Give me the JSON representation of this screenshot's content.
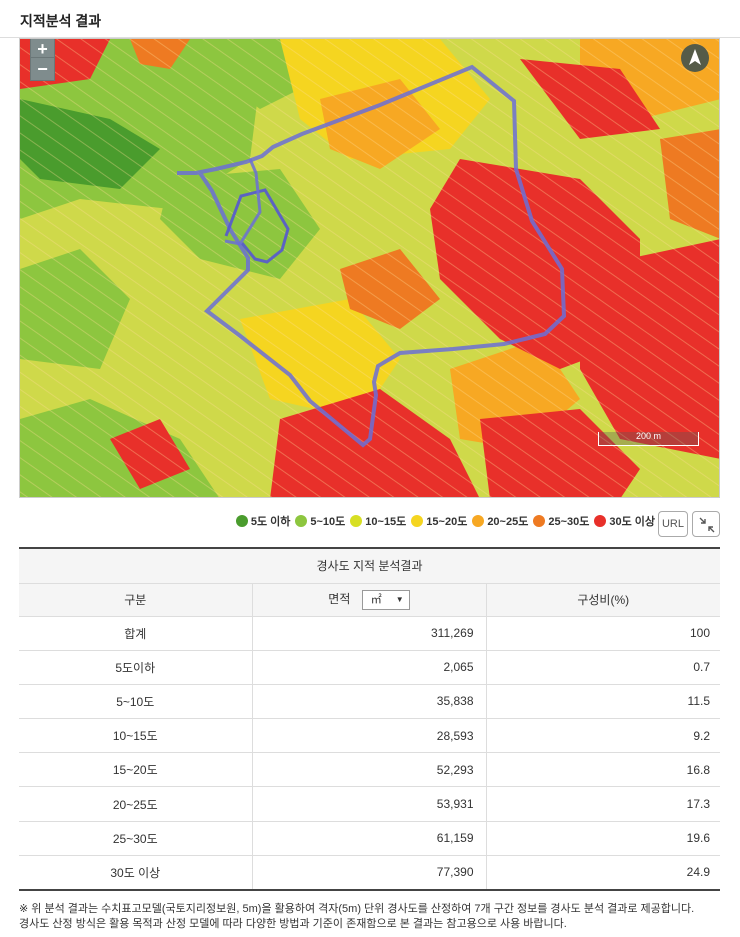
{
  "header": {
    "title": "지적분석 결과"
  },
  "map": {
    "zoom_in": "+",
    "zoom_out": "−",
    "scale_label": "200 m",
    "north_icon": "north-arrow-icon"
  },
  "legend": {
    "items": [
      {
        "label": "5도 이하",
        "color": "#4a9c2d"
      },
      {
        "label": "5~10도",
        "color": "#8dc63f"
      },
      {
        "label": "10~15도",
        "color": "#d7df23"
      },
      {
        "label": "15~20도",
        "color": "#f5d520"
      },
      {
        "label": "20~25도",
        "color": "#f7a823"
      },
      {
        "label": "25~30도",
        "color": "#ee7a22"
      },
      {
        "label": "30도 이상",
        "color": "#e8302a"
      }
    ],
    "url_button": "URL"
  },
  "table": {
    "caption": "경사도 지적 분석결과",
    "headers": {
      "category": "구분",
      "area": "면적",
      "ratio": "구성비(%)"
    },
    "unit_select": "㎡",
    "rows": [
      {
        "category": "합계",
        "area": "311,269",
        "ratio": "100"
      },
      {
        "category": "5도이하",
        "area": "2,065",
        "ratio": "0.7"
      },
      {
        "category": "5~10도",
        "area": "35,838",
        "ratio": "11.5"
      },
      {
        "category": "10~15도",
        "area": "28,593",
        "ratio": "9.2"
      },
      {
        "category": "15~20도",
        "area": "52,293",
        "ratio": "16.8"
      },
      {
        "category": "20~25도",
        "area": "53,931",
        "ratio": "17.3"
      },
      {
        "category": "25~30도",
        "area": "61,159",
        "ratio": "19.6"
      },
      {
        "category": "30도 이상",
        "area": "77,390",
        "ratio": "24.9"
      }
    ]
  },
  "note": {
    "line1": "※ 위 분석 결과는 수치표고모델(국토지리정보원, 5m)을 활용하여 격자(5m) 단위 경사도를 산정하여 7개 구간 정보를 경사도 분석 결과로 제공합니다.",
    "line2": "경사도 산정 방식은 활용 목적과 산정 모델에 따라 다양한 방법과 기준이 존재함으로 본 결과는 참고용으로 사용 바랍니다."
  }
}
